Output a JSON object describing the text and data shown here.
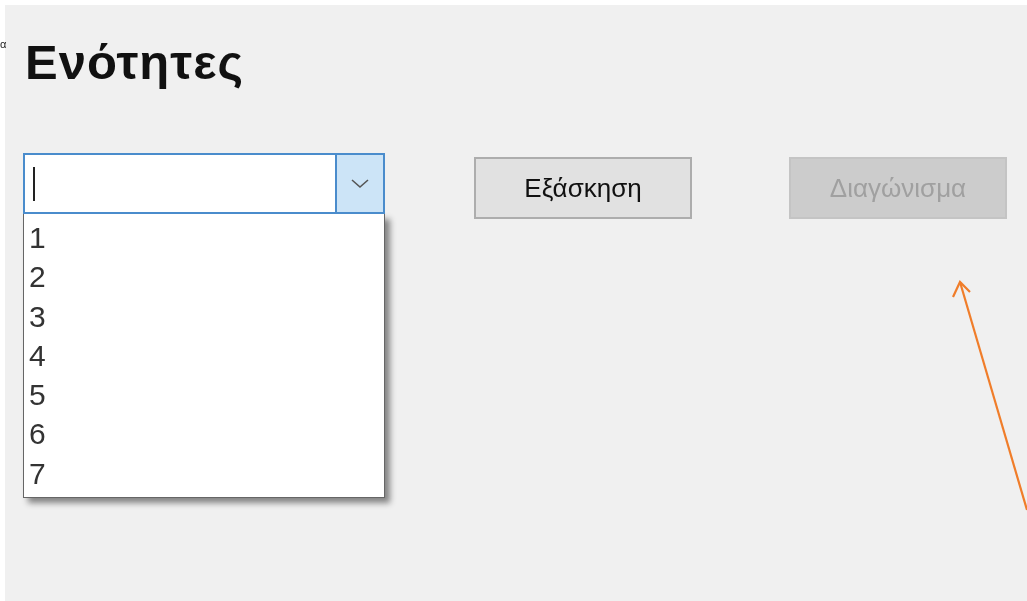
{
  "edge_mark": "α",
  "title": "Ενότητες",
  "combo": {
    "expanded": true,
    "options": [
      "1",
      "2",
      "3",
      "4",
      "5",
      "6",
      "7"
    ]
  },
  "buttons": [
    {
      "label": "Εξάσκηση",
      "disabled": false
    },
    {
      "label": "Διαγώνισμα",
      "disabled": true
    }
  ],
  "annotation": {
    "kind": "arrow"
  }
}
